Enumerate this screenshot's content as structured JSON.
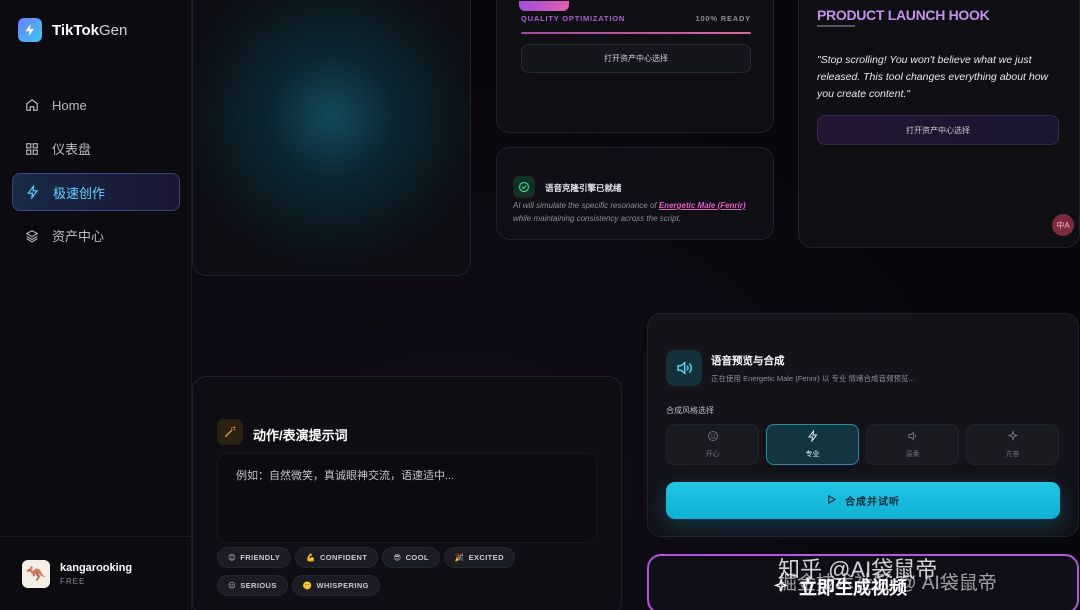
{
  "app": {
    "brand_bold": "TikTok",
    "brand_light": "Gen"
  },
  "sidebar": {
    "items": [
      {
        "label": "Home",
        "icon": "home-icon",
        "active": false
      },
      {
        "label": "仪表盘",
        "icon": "grid-icon",
        "active": false
      },
      {
        "label": "极速创作",
        "icon": "lightning-icon",
        "active": true
      },
      {
        "label": "资产中心",
        "icon": "layers-icon",
        "active": false
      }
    ],
    "user": {
      "name": "kangarooking",
      "plan": "FREE"
    }
  },
  "quality": {
    "label": "QUALITY OPTIMIZATION",
    "status": "100% READY",
    "button": "打开资产中心选择",
    "progress": 1.0
  },
  "voice_ready": {
    "title": "语音克隆引擎已就绪",
    "desc_before": "AI will simulate the specific resonance of ",
    "voice_name": "Energetic Male (Fenrir)",
    "desc_after": " while maintaining consistency across the script."
  },
  "hook": {
    "title": "PRODUCT LAUNCH HOOK",
    "quote": "\"Stop scrolling! You won't believe what we just released. This tool changes everything about how you create content.\"",
    "button": "打开资产中心选择"
  },
  "translate_fab": {
    "label": "中A"
  },
  "prompt": {
    "title": "动作/表演提示词",
    "text": "例如：自然微笑，真诚眼神交流，语速适中...",
    "chips": [
      {
        "emoji": "😊",
        "label": "FRIENDLY"
      },
      {
        "emoji": "💪",
        "label": "CONFIDENT"
      },
      {
        "emoji": "😎",
        "label": "COOL"
      },
      {
        "emoji": "🎉",
        "label": "EXCITED"
      },
      {
        "emoji": "😐",
        "label": "SERIOUS"
      },
      {
        "emoji": "🤫",
        "label": "WHISPERING"
      }
    ]
  },
  "synth": {
    "title": "语音预览与合成",
    "subtitle": "正在使用 Energetic Male (Fenrir) 以 专业 情绪合成音频预览...",
    "style_label": "合成风格选择",
    "styles": [
      {
        "label": "开心",
        "icon": "smile-icon",
        "active": false
      },
      {
        "label": "专业",
        "icon": "lightning-icon",
        "active": true
      },
      {
        "label": "温柔",
        "icon": "volume-icon",
        "active": false
      },
      {
        "label": "亢奋",
        "icon": "sparkle-icon",
        "active": false
      }
    ],
    "button": "合成并试听"
  },
  "generate": {
    "label": "立即生成视频"
  },
  "watermark": {
    "line1": "知乎 @AI袋鼠帝",
    "line2": "掘金技术社区 @ AI袋鼠帝"
  },
  "colors": {
    "accent": "#22c6e6",
    "active_nav": "#5fd7ff",
    "hook_title": "#c691ea",
    "highlight": "#e060c0"
  }
}
